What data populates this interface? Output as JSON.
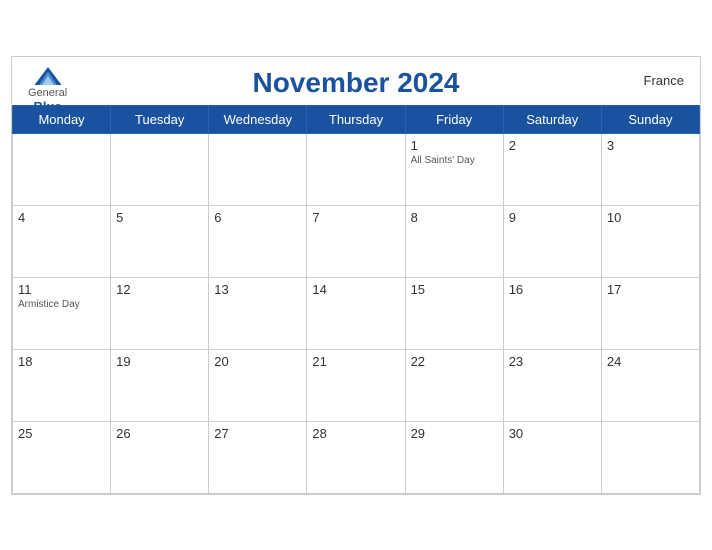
{
  "header": {
    "title": "November 2024",
    "country": "France",
    "logo": {
      "general": "General",
      "blue": "Blue"
    }
  },
  "days_of_week": [
    "Monday",
    "Tuesday",
    "Wednesday",
    "Thursday",
    "Friday",
    "Saturday",
    "Sunday"
  ],
  "weeks": [
    [
      {
        "day": "",
        "holiday": ""
      },
      {
        "day": "",
        "holiday": ""
      },
      {
        "day": "",
        "holiday": ""
      },
      {
        "day": "",
        "holiday": ""
      },
      {
        "day": "1",
        "holiday": "All Saints' Day"
      },
      {
        "day": "2",
        "holiday": ""
      },
      {
        "day": "3",
        "holiday": ""
      }
    ],
    [
      {
        "day": "4",
        "holiday": ""
      },
      {
        "day": "5",
        "holiday": ""
      },
      {
        "day": "6",
        "holiday": ""
      },
      {
        "day": "7",
        "holiday": ""
      },
      {
        "day": "8",
        "holiday": ""
      },
      {
        "day": "9",
        "holiday": ""
      },
      {
        "day": "10",
        "holiday": ""
      }
    ],
    [
      {
        "day": "11",
        "holiday": "Armistice Day"
      },
      {
        "day": "12",
        "holiday": ""
      },
      {
        "day": "13",
        "holiday": ""
      },
      {
        "day": "14",
        "holiday": ""
      },
      {
        "day": "15",
        "holiday": ""
      },
      {
        "day": "16",
        "holiday": ""
      },
      {
        "day": "17",
        "holiday": ""
      }
    ],
    [
      {
        "day": "18",
        "holiday": ""
      },
      {
        "day": "19",
        "holiday": ""
      },
      {
        "day": "20",
        "holiday": ""
      },
      {
        "day": "21",
        "holiday": ""
      },
      {
        "day": "22",
        "holiday": ""
      },
      {
        "day": "23",
        "holiday": ""
      },
      {
        "day": "24",
        "holiday": ""
      }
    ],
    [
      {
        "day": "25",
        "holiday": ""
      },
      {
        "day": "26",
        "holiday": ""
      },
      {
        "day": "27",
        "holiday": ""
      },
      {
        "day": "28",
        "holiday": ""
      },
      {
        "day": "29",
        "holiday": ""
      },
      {
        "day": "30",
        "holiday": ""
      },
      {
        "day": "",
        "holiday": ""
      }
    ]
  ]
}
